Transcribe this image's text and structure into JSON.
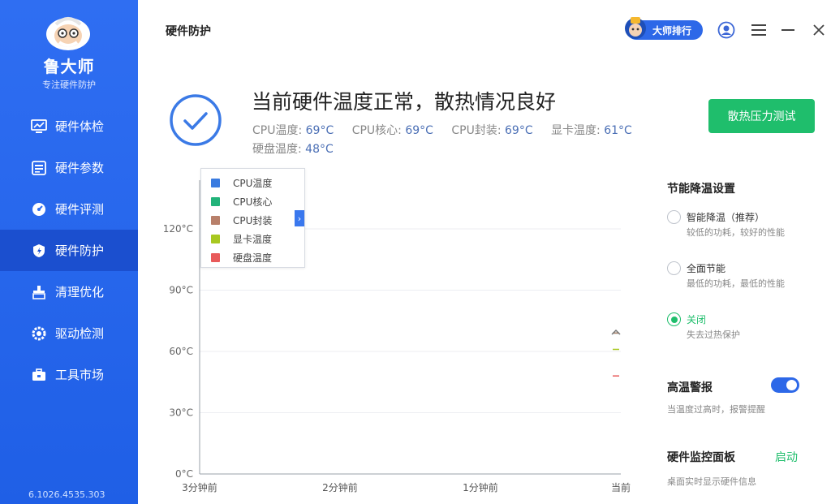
{
  "sidebar": {
    "brand": "鲁大师",
    "subtitle": "专注硬件防护",
    "version": "6.1026.4535.303",
    "items": [
      {
        "label": "硬件体检",
        "icon": "monitor-chart-icon"
      },
      {
        "label": "硬件参数",
        "icon": "list-icon"
      },
      {
        "label": "硬件评测",
        "icon": "gauge-icon"
      },
      {
        "label": "硬件防护",
        "icon": "shield-icon",
        "active": true
      },
      {
        "label": "清理优化",
        "icon": "broom-icon"
      },
      {
        "label": "驱动检测",
        "icon": "gear-icon"
      },
      {
        "label": "工具市场",
        "icon": "toolbox-icon"
      }
    ]
  },
  "header": {
    "title": "硬件防护",
    "rank_label": "大师排行"
  },
  "status": {
    "title": "当前硬件温度正常，散热情况良好",
    "stress_button": "散热压力测试",
    "temps": [
      {
        "label": "CPU温度:",
        "value": "69°C"
      },
      {
        "label": "CPU核心:",
        "value": "69°C"
      },
      {
        "label": "CPU封装:",
        "value": "69°C"
      },
      {
        "label": "显卡温度:",
        "value": "61°C"
      },
      {
        "label": "硬盘温度:",
        "value": "48°C"
      }
    ]
  },
  "legend": [
    {
      "label": "CPU温度",
      "color": "#3a7be0"
    },
    {
      "label": "CPU核心",
      "color": "#22b37a"
    },
    {
      "label": "CPU封装",
      "color": "#b8806a"
    },
    {
      "label": "显卡温度",
      "color": "#a8c820"
    },
    {
      "label": "硬盘温度",
      "color": "#e85a5a"
    }
  ],
  "chart_data": {
    "type": "line",
    "x_ticks": [
      "3分钟前",
      "2分钟前",
      "1分钟前",
      "当前"
    ],
    "y_ticks": [
      "0°C",
      "30°C",
      "60°C",
      "90°C",
      "120°C"
    ],
    "ylim": [
      0,
      120
    ],
    "grid": true,
    "legend_position": "top-left",
    "series": [
      {
        "name": "CPU温度",
        "color": "#3a7be0",
        "points": [
          [
            0,
            69
          ]
        ]
      },
      {
        "name": "CPU核心",
        "color": "#22b37a",
        "points": [
          [
            0,
            69
          ]
        ]
      },
      {
        "name": "CPU封装",
        "color": "#b8806a",
        "points": [
          [
            0,
            69
          ]
        ]
      },
      {
        "name": "显卡温度",
        "color": "#a8c820",
        "points": [
          [
            0,
            61
          ]
        ]
      },
      {
        "name": "硬盘温度",
        "color": "#e85a5a",
        "points": [
          [
            0,
            48
          ]
        ]
      }
    ]
  },
  "right_panel": {
    "energy_title": "节能降温设置",
    "options": [
      {
        "label": "智能降温（推荐）",
        "desc": "较低的功耗，较好的性能",
        "selected": false
      },
      {
        "label": "全面节能",
        "desc": "最低的功耗，最低的性能",
        "selected": false
      },
      {
        "label": "关闭",
        "desc": "失去过热保护",
        "selected": true
      }
    ],
    "alarm_title": "高温警报",
    "alarm_desc": "当温度过高时，报警提醒",
    "alarm_on": true,
    "monitor_title": "硬件监控面板",
    "monitor_action": "启动",
    "monitor_desc": "桌面实时显示硬件信息"
  }
}
